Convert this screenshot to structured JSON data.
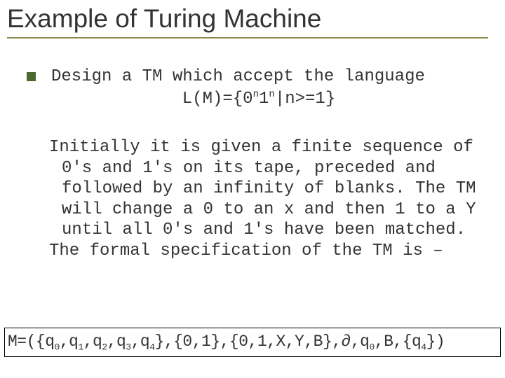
{
  "title": "Example of Turing Machine",
  "body": {
    "line1": "Design a TM which accept the language",
    "lang_prefix": "L(M)={0",
    "lang_sup1": "n",
    "lang_mid": "1",
    "lang_sup2": "n",
    "lang_suffix": "|n>=1}",
    "para2": "Initially it is given a finite sequence of 0's and 1's on its tape, preceded and followed by an infinity of blanks. The TM will change a 0 to an x and then 1 to a Y until all 0's and 1's have been matched.",
    "para3": "The formal specification of the TM is –"
  },
  "spec": {
    "p0": "M=({q",
    "s0": "0",
    "p1": ",q",
    "s1": "1",
    "p2": ",q",
    "s2": "2",
    "p3": ",q",
    "s3": "3",
    "p4": ",q",
    "s4": "4",
    "p5": "},{0,1},{0,1,X,Y,B},∂,q",
    "s5": "0",
    "p6": ",B,{q",
    "s6": "4",
    "p7": "})"
  }
}
